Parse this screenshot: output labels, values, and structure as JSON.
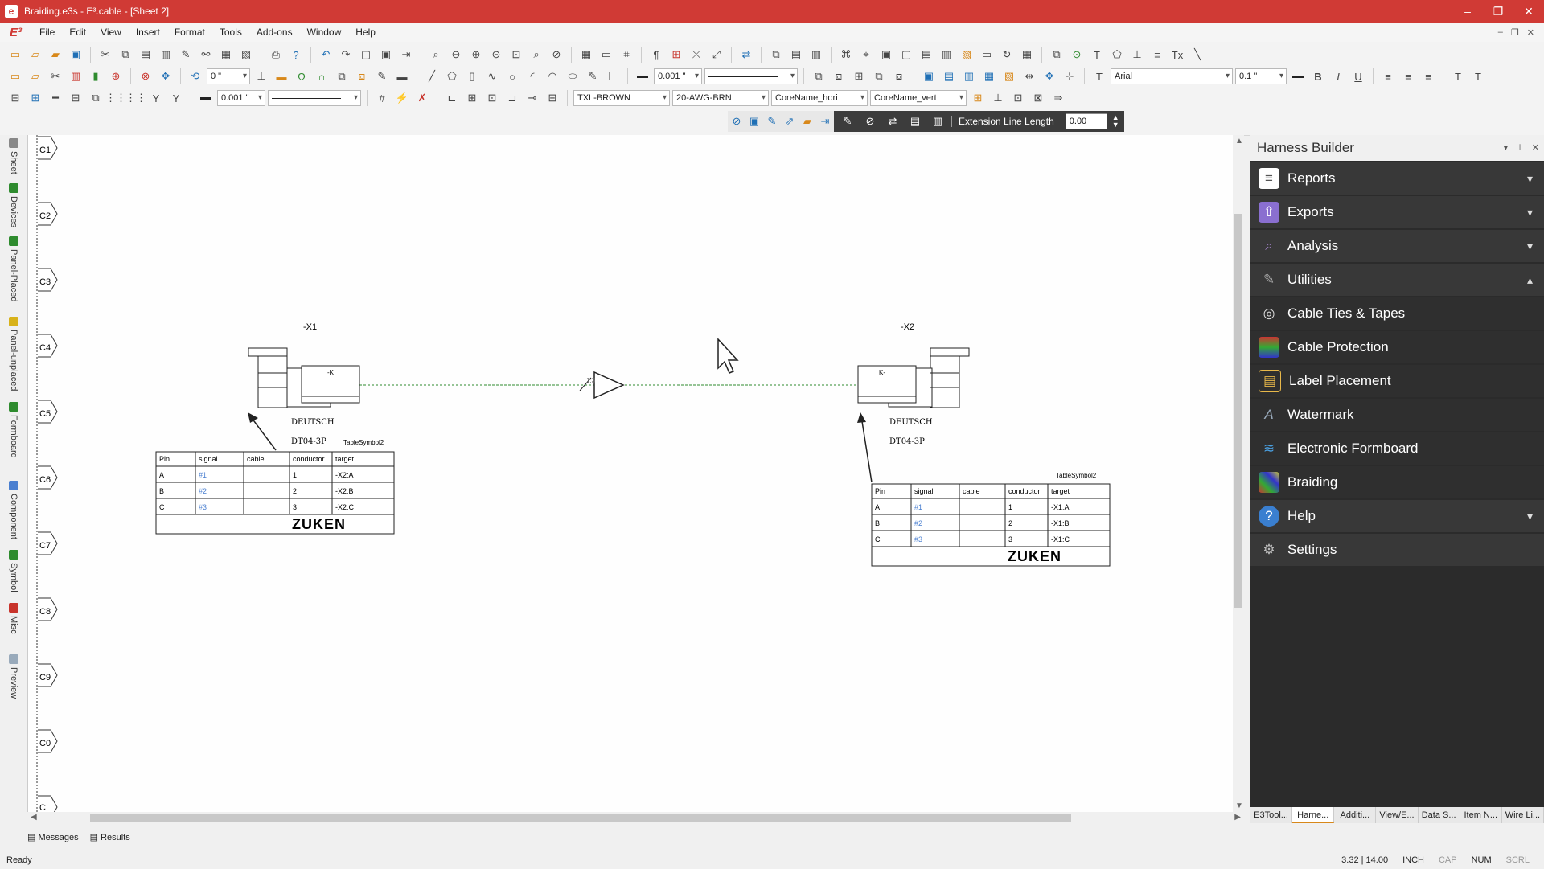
{
  "window": {
    "title": "Braiding.e3s - E³.cable - [Sheet 2]",
    "app_logo": "E³"
  },
  "menu": [
    "File",
    "Edit",
    "View",
    "Insert",
    "Format",
    "Tools",
    "Add-ons",
    "Window",
    "Help"
  ],
  "toolbar": {
    "dim1": "0 \"",
    "line_width": "0.001 \"",
    "font": "Arial",
    "font_size": "0.1 \"",
    "line_width2": "0.001 \"",
    "wire_color": "TXL-BROWN",
    "wire_type": "20-AWG-BRN",
    "core_hori": "CoreName_hori",
    "core_vert": "CoreName_vert",
    "bold": "B",
    "italic": "I",
    "underline": "U"
  },
  "extension": {
    "label": "Extension Line Length",
    "value": "0.00"
  },
  "left_tabs": [
    "Sheet",
    "Devices",
    "Panel-Placed",
    "Panel-unplaced",
    "Formboard",
    "Component",
    "Symbol",
    "Misc",
    "Preview"
  ],
  "canvas": {
    "zones": [
      "C1",
      "C2",
      "C3",
      "C4",
      "C5",
      "C6",
      "C7",
      "C8",
      "C9",
      "C0",
      "C"
    ],
    "left_connector": {
      "ref": "-X1",
      "maker": "DEUTSCH",
      "part": "DT04-3P",
      "table_label": "TableSymbol2"
    },
    "right_connector": {
      "ref": "-X2",
      "maker": "DEUTSCH",
      "part": "DT04-3P",
      "table_label": "TableSymbol2"
    },
    "midlabel": "1:3",
    "table_headers": [
      "Pin",
      "signal",
      "cable",
      "conductor",
      "target"
    ],
    "left_rows": [
      [
        "A",
        "#1",
        "",
        "1",
        "-X2:A"
      ],
      [
        "B",
        "#2",
        "",
        "2",
        "-X2:B"
      ],
      [
        "C",
        "#3",
        "",
        "3",
        "-X2:C"
      ]
    ],
    "right_rows": [
      [
        "A",
        "#1",
        "",
        "1",
        "-X1:A"
      ],
      [
        "B",
        "#2",
        "",
        "2",
        "-X1:B"
      ],
      [
        "C",
        "#3",
        "",
        "3",
        "-X1:C"
      ]
    ],
    "brand": "ZUKEN"
  },
  "panel": {
    "title": "Harness Builder",
    "items": [
      {
        "label": "Reports",
        "icon": "reports-icon",
        "chev": "⌄",
        "sub": false
      },
      {
        "label": "Exports",
        "icon": "exports-icon",
        "chev": "⌄",
        "sub": false
      },
      {
        "label": "Analysis",
        "icon": "analysis-icon",
        "chev": "⌄",
        "sub": false
      },
      {
        "label": "Utilities",
        "icon": "utilities-icon",
        "chev": "⌃",
        "sub": false
      },
      {
        "label": "Cable Ties & Tapes",
        "icon": "cable-ties-icon",
        "chev": "",
        "sub": true
      },
      {
        "label": "Cable Protection",
        "icon": "cable-protection-icon",
        "chev": "",
        "sub": true
      },
      {
        "label": "Label Placement",
        "icon": "label-placement-icon",
        "chev": "",
        "sub": true
      },
      {
        "label": "Watermark",
        "icon": "watermark-icon",
        "chev": "",
        "sub": true
      },
      {
        "label": "Electronic Formboard",
        "icon": "formboard-icon",
        "chev": "",
        "sub": true
      },
      {
        "label": "Braiding",
        "icon": "braiding-icon",
        "chev": "",
        "sub": true
      },
      {
        "label": "Help",
        "icon": "help-icon",
        "chev": "⌄",
        "sub": false
      },
      {
        "label": "Settings",
        "icon": "settings-icon",
        "chev": "",
        "sub": false
      }
    ]
  },
  "bottom_tabs": [
    "E3Tool...",
    "Harne...",
    "Additi...",
    "View/E...",
    "Data S...",
    "Item N...",
    "Wire Li..."
  ],
  "messages": {
    "messages": "Messages",
    "results": "Results"
  },
  "status": {
    "ready": "Ready",
    "coords": "3.32 | 14.00",
    "unit": "INCH",
    "cap": "CAP",
    "num": "NUM",
    "scrl": "SCRL"
  },
  "colors": {
    "titlebar": "#d03a35",
    "panel": "#2b2b2b",
    "wire": "#2e8b2e",
    "signal": "#4a7fd0"
  }
}
